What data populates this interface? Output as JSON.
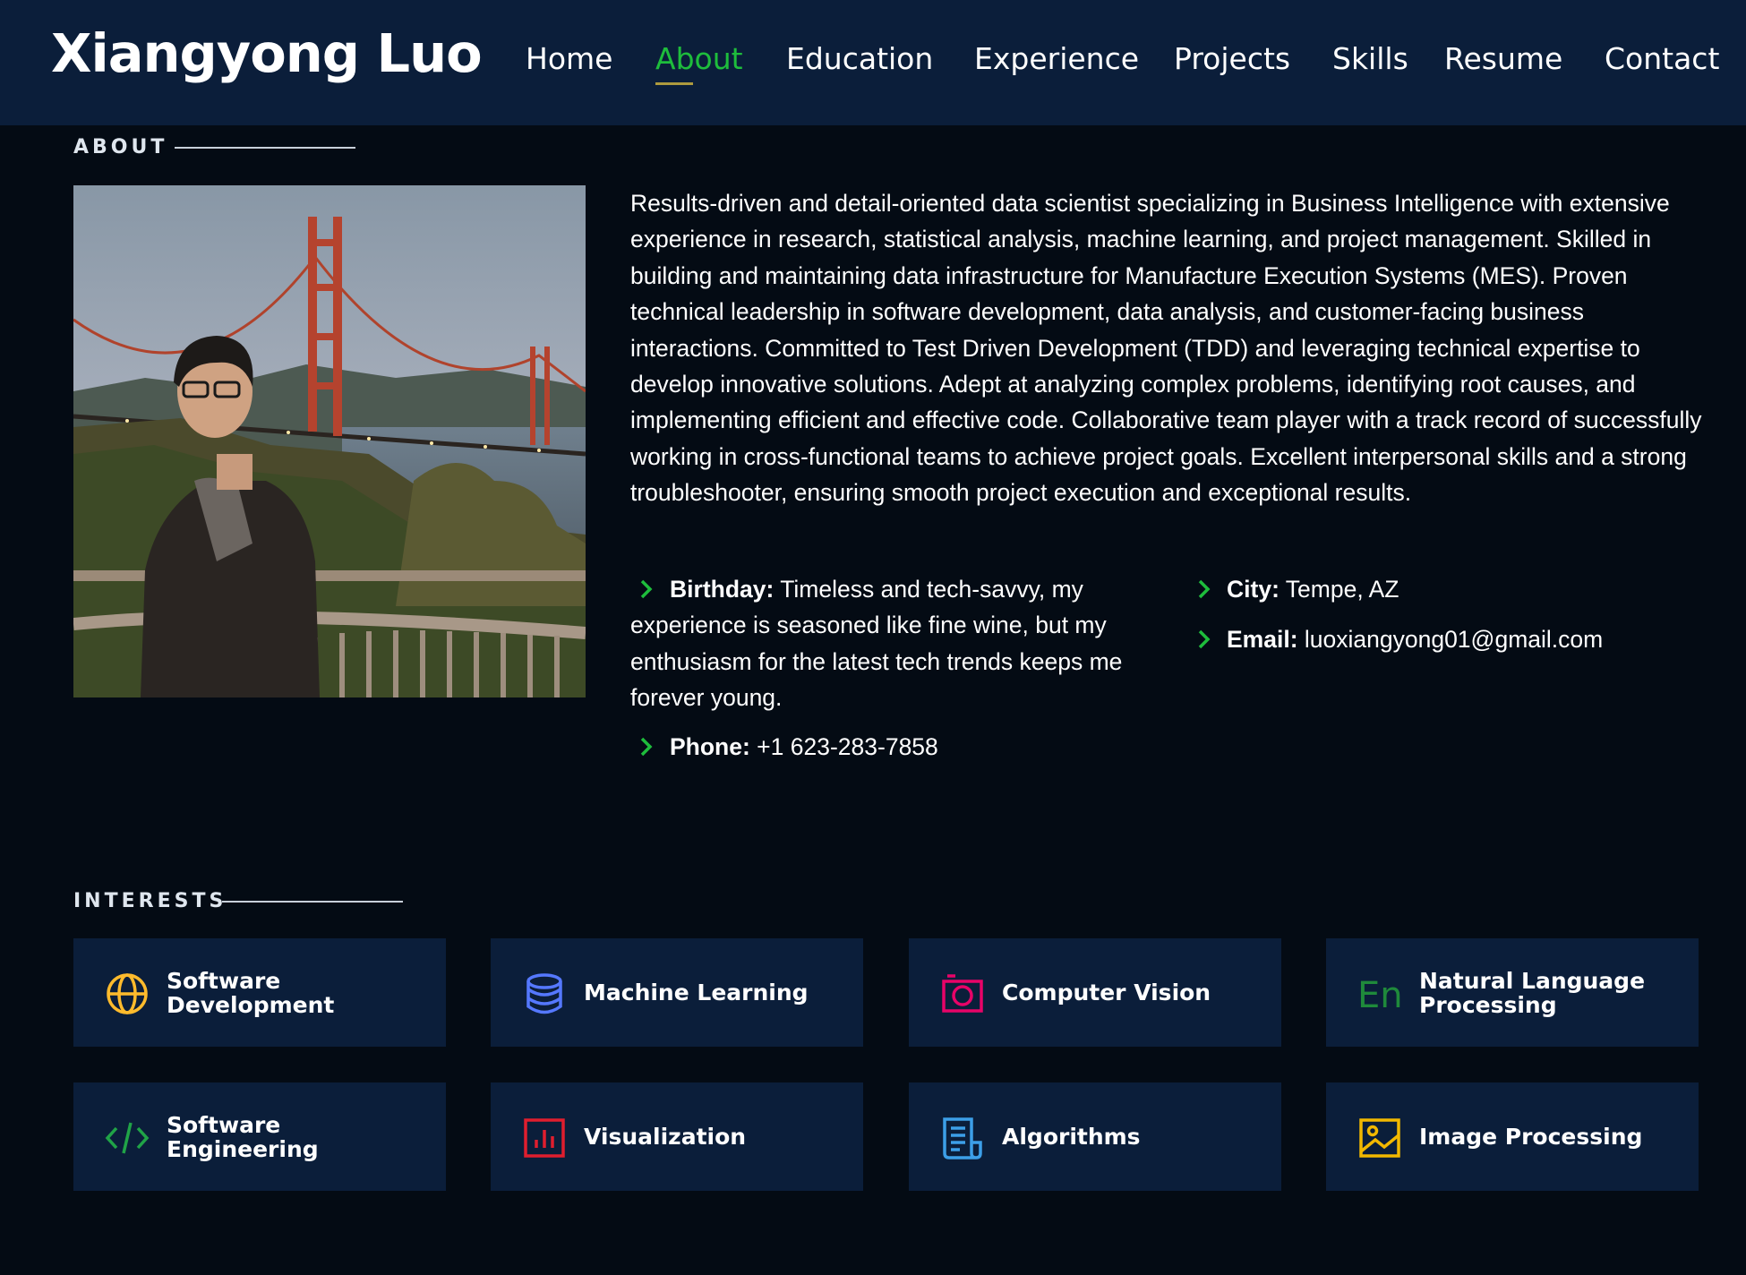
{
  "header": {
    "logo": "Xiangyong Luo",
    "nav": [
      {
        "label": "Home",
        "active": false
      },
      {
        "label": "About",
        "active": true
      },
      {
        "label": "Education",
        "active": false
      },
      {
        "label": "Experience",
        "active": false
      },
      {
        "label": "Projects",
        "active": false
      },
      {
        "label": "Skills",
        "active": false
      },
      {
        "label": "Resume",
        "active": false
      },
      {
        "label": "Contact",
        "active": false
      }
    ]
  },
  "about": {
    "section_title": "ABOUT",
    "summary": "Results-driven and detail-oriented data scientist specializing in Business Intelligence with extensive experience in research, statistical analysis, machine learning, and project management. Skilled in building and maintaining data infrastructure for Manufacture Execution Systems (MES). Proven technical leadership in software development, data analysis, and customer-facing business interactions. Committed to Test Driven Development (TDD) and leveraging technical expertise to develop innovative solutions. Adept at analyzing complex problems, identifying root causes, and implementing efficient and effective code. Collaborative team player with a track record of successfully working in cross-functional teams to achieve project goals. Excellent interpersonal skills and a strong troubleshooter, ensuring smooth project execution and exceptional results.",
    "birthday_label": "Birthday:",
    "birthday_value": " Timeless and tech-savvy, my experience is seasoned like fine wine, but my enthusiasm for the latest tech trends keeps me forever young.",
    "phone_label": "Phone:",
    "phone_value": " +1 623-283-7858",
    "city_label": "City:",
    "city_value": " Tempe, AZ",
    "email_label": "Email:",
    "email_value": " luoxiangyong01@gmail.com"
  },
  "interests": {
    "section_title": "INTERESTS",
    "items": [
      {
        "label": "Software Development",
        "icon": "globe-icon",
        "color": "#ffbb2c"
      },
      {
        "label": "Machine Learning",
        "icon": "database-icon",
        "color": "#5578ff"
      },
      {
        "label": "Computer Vision",
        "icon": "camera-icon",
        "color": "#e80368"
      },
      {
        "label": "Natural Language Processing",
        "icon": "language-icon",
        "color": "#1f8a3b"
      },
      {
        "label": "Software Engineering",
        "icon": "code-icon",
        "color": "#20a347"
      },
      {
        "label": "Visualization",
        "icon": "bar-chart-icon",
        "color": "#e01e2e"
      },
      {
        "label": "Algorithms",
        "icon": "document-icon",
        "color": "#3c9fe8"
      },
      {
        "label": "Image Processing",
        "icon": "image-icon",
        "color": "#f2b800"
      }
    ]
  },
  "colors": {
    "accent": "#1ebd3c",
    "header_bg": "#0b1e3a",
    "page_bg": "#040b14"
  }
}
